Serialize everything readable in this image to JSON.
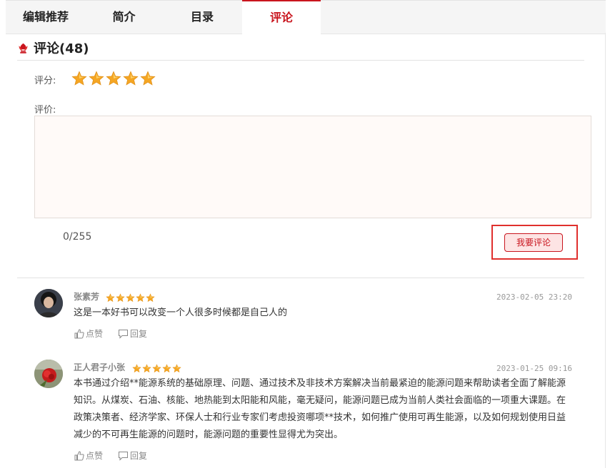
{
  "tabs": [
    {
      "label": "编辑推荐"
    },
    {
      "label": "简介"
    },
    {
      "label": "目录"
    },
    {
      "label": "评论"
    }
  ],
  "active_tab_index": 3,
  "section": {
    "title": "评论(48)"
  },
  "rating_form": {
    "score_label": "评分:",
    "score": 5,
    "score_max": 5,
    "review_label": "评价:",
    "review_value": "",
    "counter": "0/255",
    "submit_label": "我要评论"
  },
  "comments": [
    {
      "user": "张素芳",
      "stars": 5,
      "date": "2023-02-05 23:20",
      "text": "这是一本好书可以改变一个人很多时候都是自己人的",
      "like_label": "点赞",
      "reply_label": "回复"
    },
    {
      "user": "正人君子小张",
      "stars": 5,
      "date": "2023-01-25 09:16",
      "text_lines": [
        "本书通过介绍**能源系统的基础原理、问题、通过技术及非技术方案解决当前最紧迫的能源问题来帮助读者全面了解能源",
        "知识。从煤炭、石油、核能、地热能到太阳能和风能，毫无疑问，能源问题已成为当前人类社会面临的一项重大课题。在",
        "政策决策者、经济学家、环保人士和行业专家们考虑投资哪项**技术，如何推广使用可再生能源，以及如何规划使用日益",
        "减少的不可再生能源的问题时，能源问题的重要性显得尤为突出。"
      ],
      "like_label": "点赞",
      "reply_label": "回复"
    }
  ],
  "colors": {
    "accent": "#c9151e",
    "star": "#f5a623",
    "highlight": "#e0302d"
  }
}
